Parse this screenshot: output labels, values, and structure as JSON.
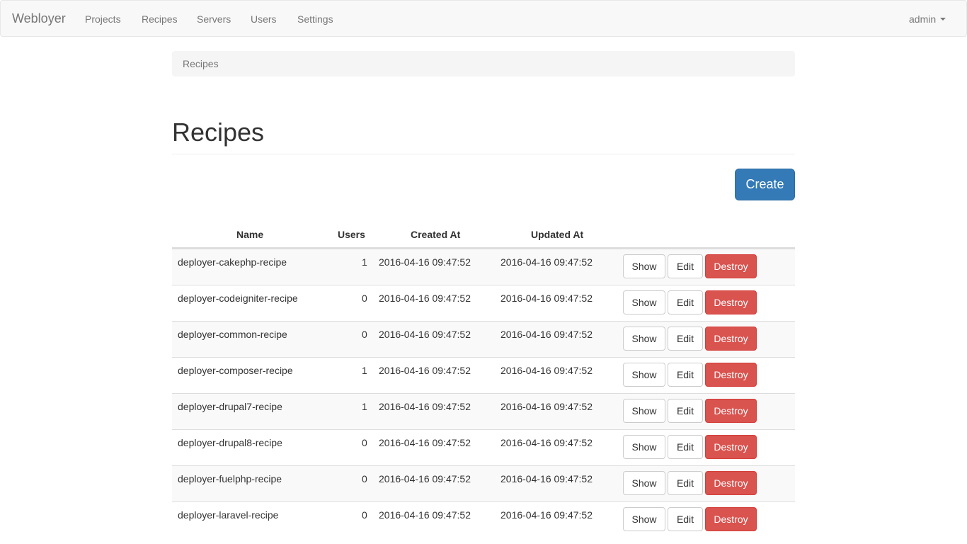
{
  "navbar": {
    "brand": "Webloyer",
    "items": [
      "Projects",
      "Recipes",
      "Servers",
      "Users",
      "Settings"
    ],
    "user": "admin"
  },
  "breadcrumb": "Recipes",
  "page": {
    "title": "Recipes",
    "create_label": "Create"
  },
  "table": {
    "headers": {
      "name": "Name",
      "users": "Users",
      "created_at": "Created At",
      "updated_at": "Updated At"
    },
    "actions": {
      "show": "Show",
      "edit": "Edit",
      "destroy": "Destroy"
    },
    "rows": [
      {
        "name": "deployer-cakephp-recipe",
        "users": "1",
        "created_at": "2016-04-16 09:47:52",
        "updated_at": "2016-04-16 09:47:52"
      },
      {
        "name": "deployer-codeigniter-recipe",
        "users": "0",
        "created_at": "2016-04-16 09:47:52",
        "updated_at": "2016-04-16 09:47:52"
      },
      {
        "name": "deployer-common-recipe",
        "users": "0",
        "created_at": "2016-04-16 09:47:52",
        "updated_at": "2016-04-16 09:47:52"
      },
      {
        "name": "deployer-composer-recipe",
        "users": "1",
        "created_at": "2016-04-16 09:47:52",
        "updated_at": "2016-04-16 09:47:52"
      },
      {
        "name": "deployer-drupal7-recipe",
        "users": "1",
        "created_at": "2016-04-16 09:47:52",
        "updated_at": "2016-04-16 09:47:52"
      },
      {
        "name": "deployer-drupal8-recipe",
        "users": "0",
        "created_at": "2016-04-16 09:47:52",
        "updated_at": "2016-04-16 09:47:52"
      },
      {
        "name": "deployer-fuelphp-recipe",
        "users": "0",
        "created_at": "2016-04-16 09:47:52",
        "updated_at": "2016-04-16 09:47:52"
      },
      {
        "name": "deployer-laravel-recipe",
        "users": "0",
        "created_at": "2016-04-16 09:47:52",
        "updated_at": "2016-04-16 09:47:52"
      }
    ]
  },
  "colors": {
    "primary": "#337ab7",
    "danger": "#d9534f",
    "navbar_bg": "#f8f8f8"
  }
}
